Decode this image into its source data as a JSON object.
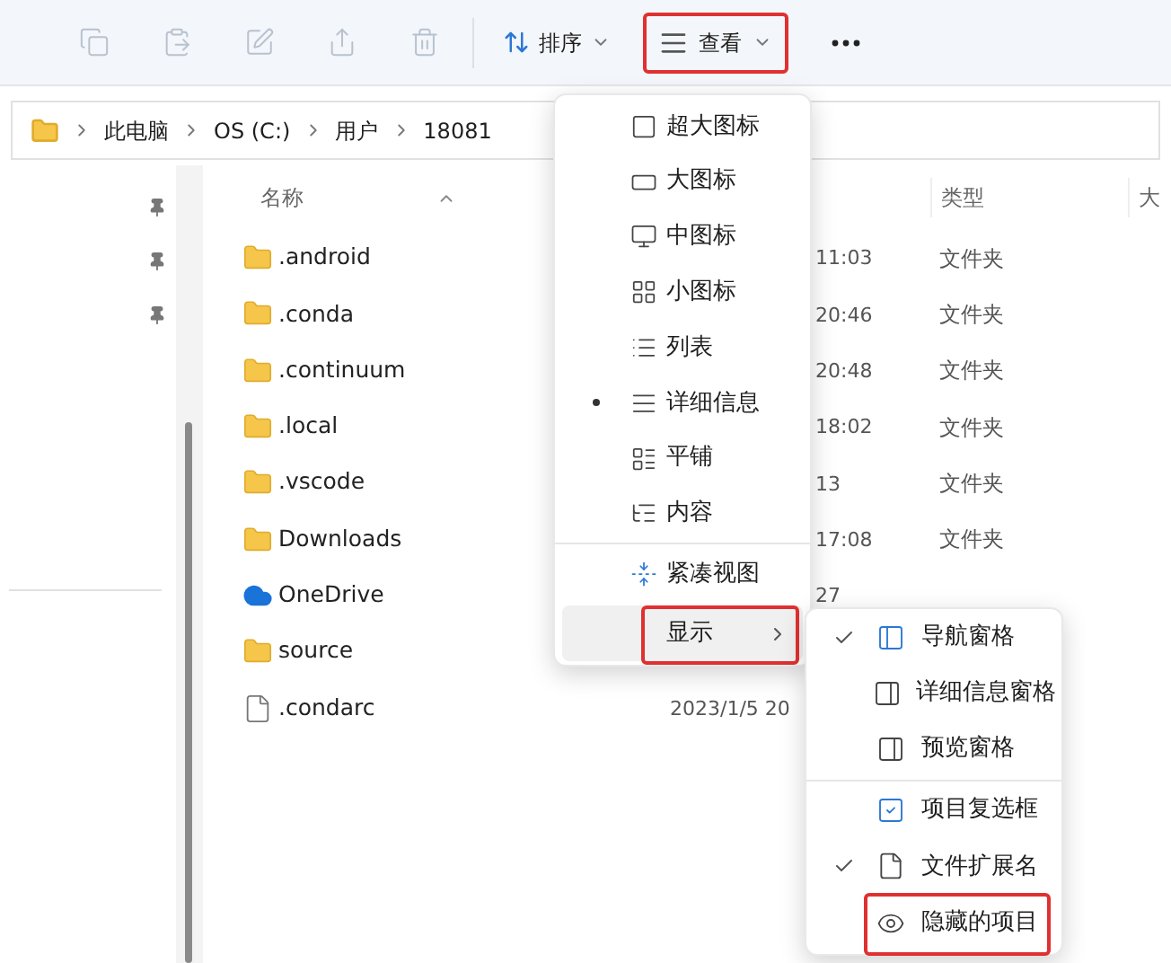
{
  "toolbar": {
    "actions": [
      {
        "kind": "copy",
        "disabled": true
      },
      {
        "kind": "paste",
        "disabled": true
      },
      {
        "kind": "rename",
        "disabled": true
      },
      {
        "kind": "share",
        "disabled": true
      },
      {
        "kind": "delete",
        "disabled": true
      }
    ],
    "sort": {
      "label": "排序"
    },
    "view": {
      "label": "查看",
      "highlighted": true
    }
  },
  "breadcrumb": [
    "此电脑",
    "OS (C:)",
    "用户",
    "18081"
  ],
  "columns": [
    {
      "label": "名称",
      "sorted": true
    },
    {
      "label": "类型",
      "sorted": false
    },
    {
      "label": "大",
      "sorted": false
    }
  ],
  "rows": [
    {
      "kind": "folder",
      "name": ".android",
      "date": "11:03",
      "date_clipped": true,
      "type": "文件夹"
    },
    {
      "kind": "folder",
      "name": ".conda",
      "date": "20:46",
      "date_clipped": true,
      "type": "文件夹"
    },
    {
      "kind": "folder",
      "name": ".continuum",
      "date": "20:48",
      "date_clipped": true,
      "type": "文件夹"
    },
    {
      "kind": "folder",
      "name": ".local",
      "date": "18:02",
      "date_clipped": true,
      "type": "文件夹"
    },
    {
      "kind": "folder",
      "name": ".vscode",
      "date": "13",
      "date_clipped": true,
      "type": "文件夹"
    },
    {
      "kind": "folder",
      "name": "Downloads",
      "date": "17:08",
      "date_clipped": true,
      "type": "文件夹"
    },
    {
      "kind": "cloud",
      "name": "OneDrive",
      "date": "27",
      "date_clipped": true
    },
    {
      "kind": "folder",
      "name": "source"
    },
    {
      "kind": "file",
      "name": ".condarc",
      "date": "2023/1/5 20",
      "date_clipped": false
    }
  ],
  "view_menu": [
    {
      "kind": "extra-large",
      "label": "超大图标",
      "selected": false
    },
    {
      "kind": "large",
      "label": "大图标",
      "selected": false
    },
    {
      "kind": "medium",
      "label": "中图标",
      "selected": false
    },
    {
      "kind": "small",
      "label": "小图标",
      "selected": false
    },
    {
      "kind": "list",
      "label": "列表",
      "selected": false
    },
    {
      "kind": "details",
      "label": "详细信息",
      "selected": true
    },
    {
      "kind": "tiles",
      "label": "平铺",
      "selected": false
    },
    {
      "kind": "content",
      "label": "内容",
      "selected": false
    },
    {
      "kind": "separator"
    },
    {
      "kind": "compact",
      "label": "紧凑视图",
      "selected": false
    },
    {
      "kind": "submenu",
      "label": "显示",
      "hovered": true,
      "highlighted": true
    }
  ],
  "show_menu": [
    {
      "kind": "navigation-pane",
      "label": "导航窗格",
      "checked": true,
      "highlighted": false
    },
    {
      "kind": "details-pane",
      "label": "详细信息窗格",
      "checked": false,
      "highlighted": false
    },
    {
      "kind": "preview-pane",
      "label": "预览窗格",
      "checked": false,
      "highlighted": false
    },
    {
      "kind": "separator"
    },
    {
      "kind": "item-checkboxes",
      "label": "项目复选框",
      "checked": false,
      "highlighted": false
    },
    {
      "kind": "file-extensions",
      "label": "文件扩展名",
      "checked": true,
      "highlighted": false
    },
    {
      "kind": "hidden-items",
      "label": "隐藏的项目",
      "checked": false,
      "highlighted": true
    }
  ]
}
